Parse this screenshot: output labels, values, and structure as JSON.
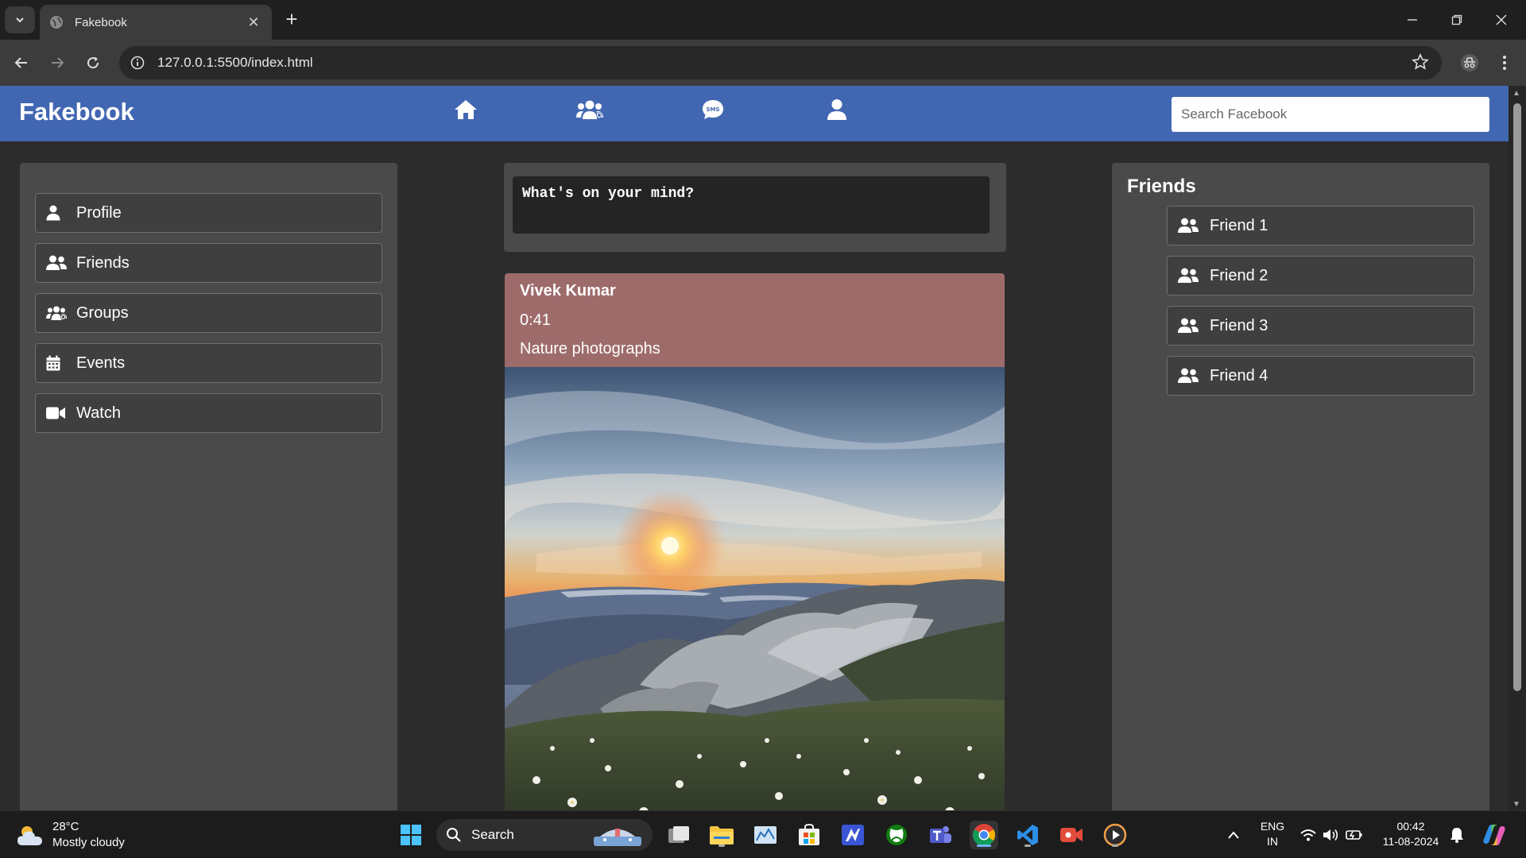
{
  "browser": {
    "tab_title": "Fakebook",
    "tab_close": "✕",
    "new_tab": "+",
    "url": "127.0.0.1:5500/index.html"
  },
  "header": {
    "brand": "Fakebook",
    "search_placeholder": "Search Facebook",
    "nav_icons": [
      "home-icon",
      "groups-icon",
      "messages-icon",
      "profile-icon"
    ],
    "color": "#4267b2"
  },
  "sidebar": {
    "items": [
      {
        "label": "Profile",
        "icon": "user-icon"
      },
      {
        "label": "Friends",
        "icon": "user-friends-icon"
      },
      {
        "label": "Groups",
        "icon": "users-icon"
      },
      {
        "label": "Events",
        "icon": "calendar-icon"
      },
      {
        "label": "Watch",
        "icon": "video-icon"
      }
    ]
  },
  "composer": {
    "placeholder": "What's on your mind?"
  },
  "post": {
    "author": "Vivek Kumar",
    "time": "0:41",
    "text": "Nature photographs",
    "header_color": "#9e6b6b"
  },
  "friends": {
    "title": "Friends",
    "items": [
      "Friend 1",
      "Friend 2",
      "Friend 3",
      "Friend 4"
    ]
  },
  "taskbar": {
    "weather_temp": "28°C",
    "weather_desc": "Mostly cloudy",
    "search_label": "Search",
    "lang_top": "ENG",
    "lang_bottom": "IN",
    "time": "00:42",
    "date": "11-08-2024"
  }
}
